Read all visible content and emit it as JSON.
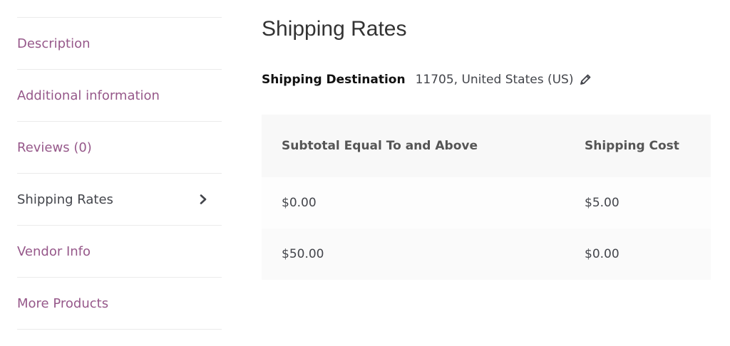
{
  "sidebar": {
    "tabs": [
      {
        "label": "Description",
        "active": false
      },
      {
        "label": "Additional information",
        "active": false
      },
      {
        "label": "Reviews (0)",
        "active": false
      },
      {
        "label": "Shipping Rates",
        "active": true,
        "icon": "chevron-right-icon"
      },
      {
        "label": "Vendor Info",
        "active": false
      },
      {
        "label": "More Products",
        "active": false
      }
    ]
  },
  "main": {
    "title": "Shipping Rates",
    "destination": {
      "label": "Shipping Destination",
      "value": "11705, United States (US)",
      "edit_icon": "pencil-icon"
    },
    "table": {
      "headers": [
        "Subtotal Equal To and Above",
        "Shipping Cost"
      ],
      "rows": [
        [
          "$0.00",
          "$5.00"
        ],
        [
          "$50.00",
          "$0.00"
        ]
      ]
    }
  },
  "colors": {
    "link": "#96588a",
    "active_text": "#43454b",
    "table_header_bg": "#f8f8f8",
    "divider": "#ebebeb"
  }
}
